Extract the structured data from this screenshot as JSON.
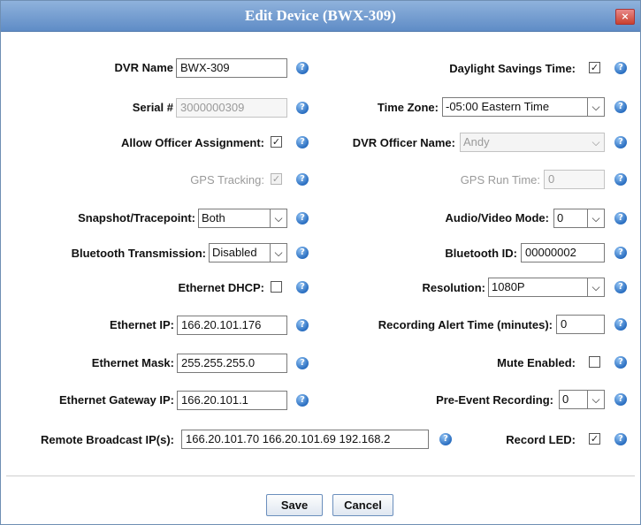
{
  "dialog": {
    "title": "Edit Device (BWX-309)",
    "close_label": "×"
  },
  "left": {
    "dvr_name": {
      "label": "DVR Name",
      "value": "BWX-309"
    },
    "serial": {
      "label": "Serial #",
      "value": "3000000309"
    },
    "allow_officer": {
      "label": "Allow Officer Assignment:",
      "checked": true
    },
    "gps_tracking": {
      "label": "GPS Tracking:",
      "checked": true
    },
    "snapshot": {
      "label": "Snapshot/Tracepoint:",
      "value": "Both"
    },
    "bluetooth_tx": {
      "label": "Bluetooth Transmission:",
      "value": "Disabled"
    },
    "ethernet_dhcp": {
      "label": "Ethernet DHCP:",
      "checked": false
    },
    "ethernet_ip": {
      "label": "Ethernet IP:",
      "value": "166.20.101.176"
    },
    "ethernet_mask": {
      "label": "Ethernet Mask:",
      "value": "255.255.255.0"
    },
    "ethernet_gateway": {
      "label": "Ethernet Gateway IP:",
      "value": "166.20.101.1"
    },
    "remote_broadcast": {
      "label": "Remote Broadcast IP(s):",
      "value": "166.20.101.70 166.20.101.69 192.168.2"
    }
  },
  "right": {
    "daylight": {
      "label": "Daylight Savings Time:",
      "checked": true
    },
    "time_zone": {
      "label": "Time Zone:",
      "value": "-05:00 Eastern Time"
    },
    "dvr_officer": {
      "label": "DVR Officer Name:",
      "value": "Andy"
    },
    "gps_run_time": {
      "label": "GPS Run Time:",
      "value": "0"
    },
    "av_mode": {
      "label": "Audio/Video Mode:",
      "value": "0"
    },
    "bluetooth_id": {
      "label": "Bluetooth ID:",
      "value": "00000002"
    },
    "resolution": {
      "label": "Resolution:",
      "value": "1080P"
    },
    "rec_alert": {
      "label": "Recording Alert Time (minutes):",
      "value": "0"
    },
    "mute": {
      "label": "Mute Enabled:",
      "checked": false
    },
    "pre_event": {
      "label": "Pre-Event Recording:",
      "value": "0"
    },
    "record_led": {
      "label": "Record LED:",
      "checked": true
    }
  },
  "buttons": {
    "save": "Save",
    "cancel": "Cancel"
  },
  "glyphs": {
    "check": "✓",
    "dropdown": "⌵",
    "help": "?"
  },
  "colors": {
    "titlebar": "#6f98cf",
    "help_icon": "#2b6fc1",
    "close": "#c9412f"
  }
}
